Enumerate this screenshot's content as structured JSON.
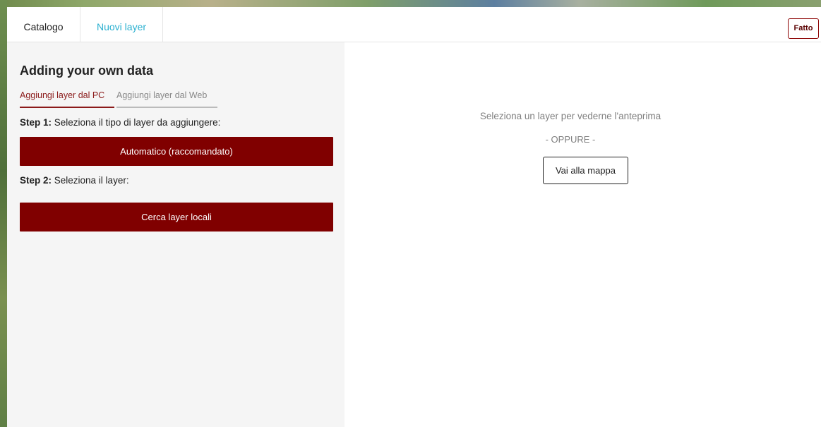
{
  "tabs": [
    {
      "label": "Catalogo",
      "active": false
    },
    {
      "label": "Nuovi layer",
      "active": true
    }
  ],
  "done_label": "Fatto",
  "panel": {
    "title": "Adding your own data",
    "subtabs": [
      {
        "label": "Aggiungi layer dal PC",
        "active": true
      },
      {
        "label": "Aggiungi layer dal Web",
        "active": false
      }
    ],
    "step1": {
      "prefix": "Step 1:",
      "text": " Seleziona il tipo di layer da aggiungere:"
    },
    "type_select_value": "Automatico (raccomandato)",
    "step2": {
      "prefix": "Step 2:",
      "text": " Seleziona il layer:"
    },
    "browse_label": "Cerca layer locali"
  },
  "preview": {
    "hint": "Seleziona un layer per vederne l'anteprima",
    "or": "- OPPURE -",
    "map_button": "Vai alla mappa"
  },
  "colors": {
    "accent": "#800000",
    "active_tab": "#2ab0d0",
    "panel_bg": "#f5f5f5"
  }
}
